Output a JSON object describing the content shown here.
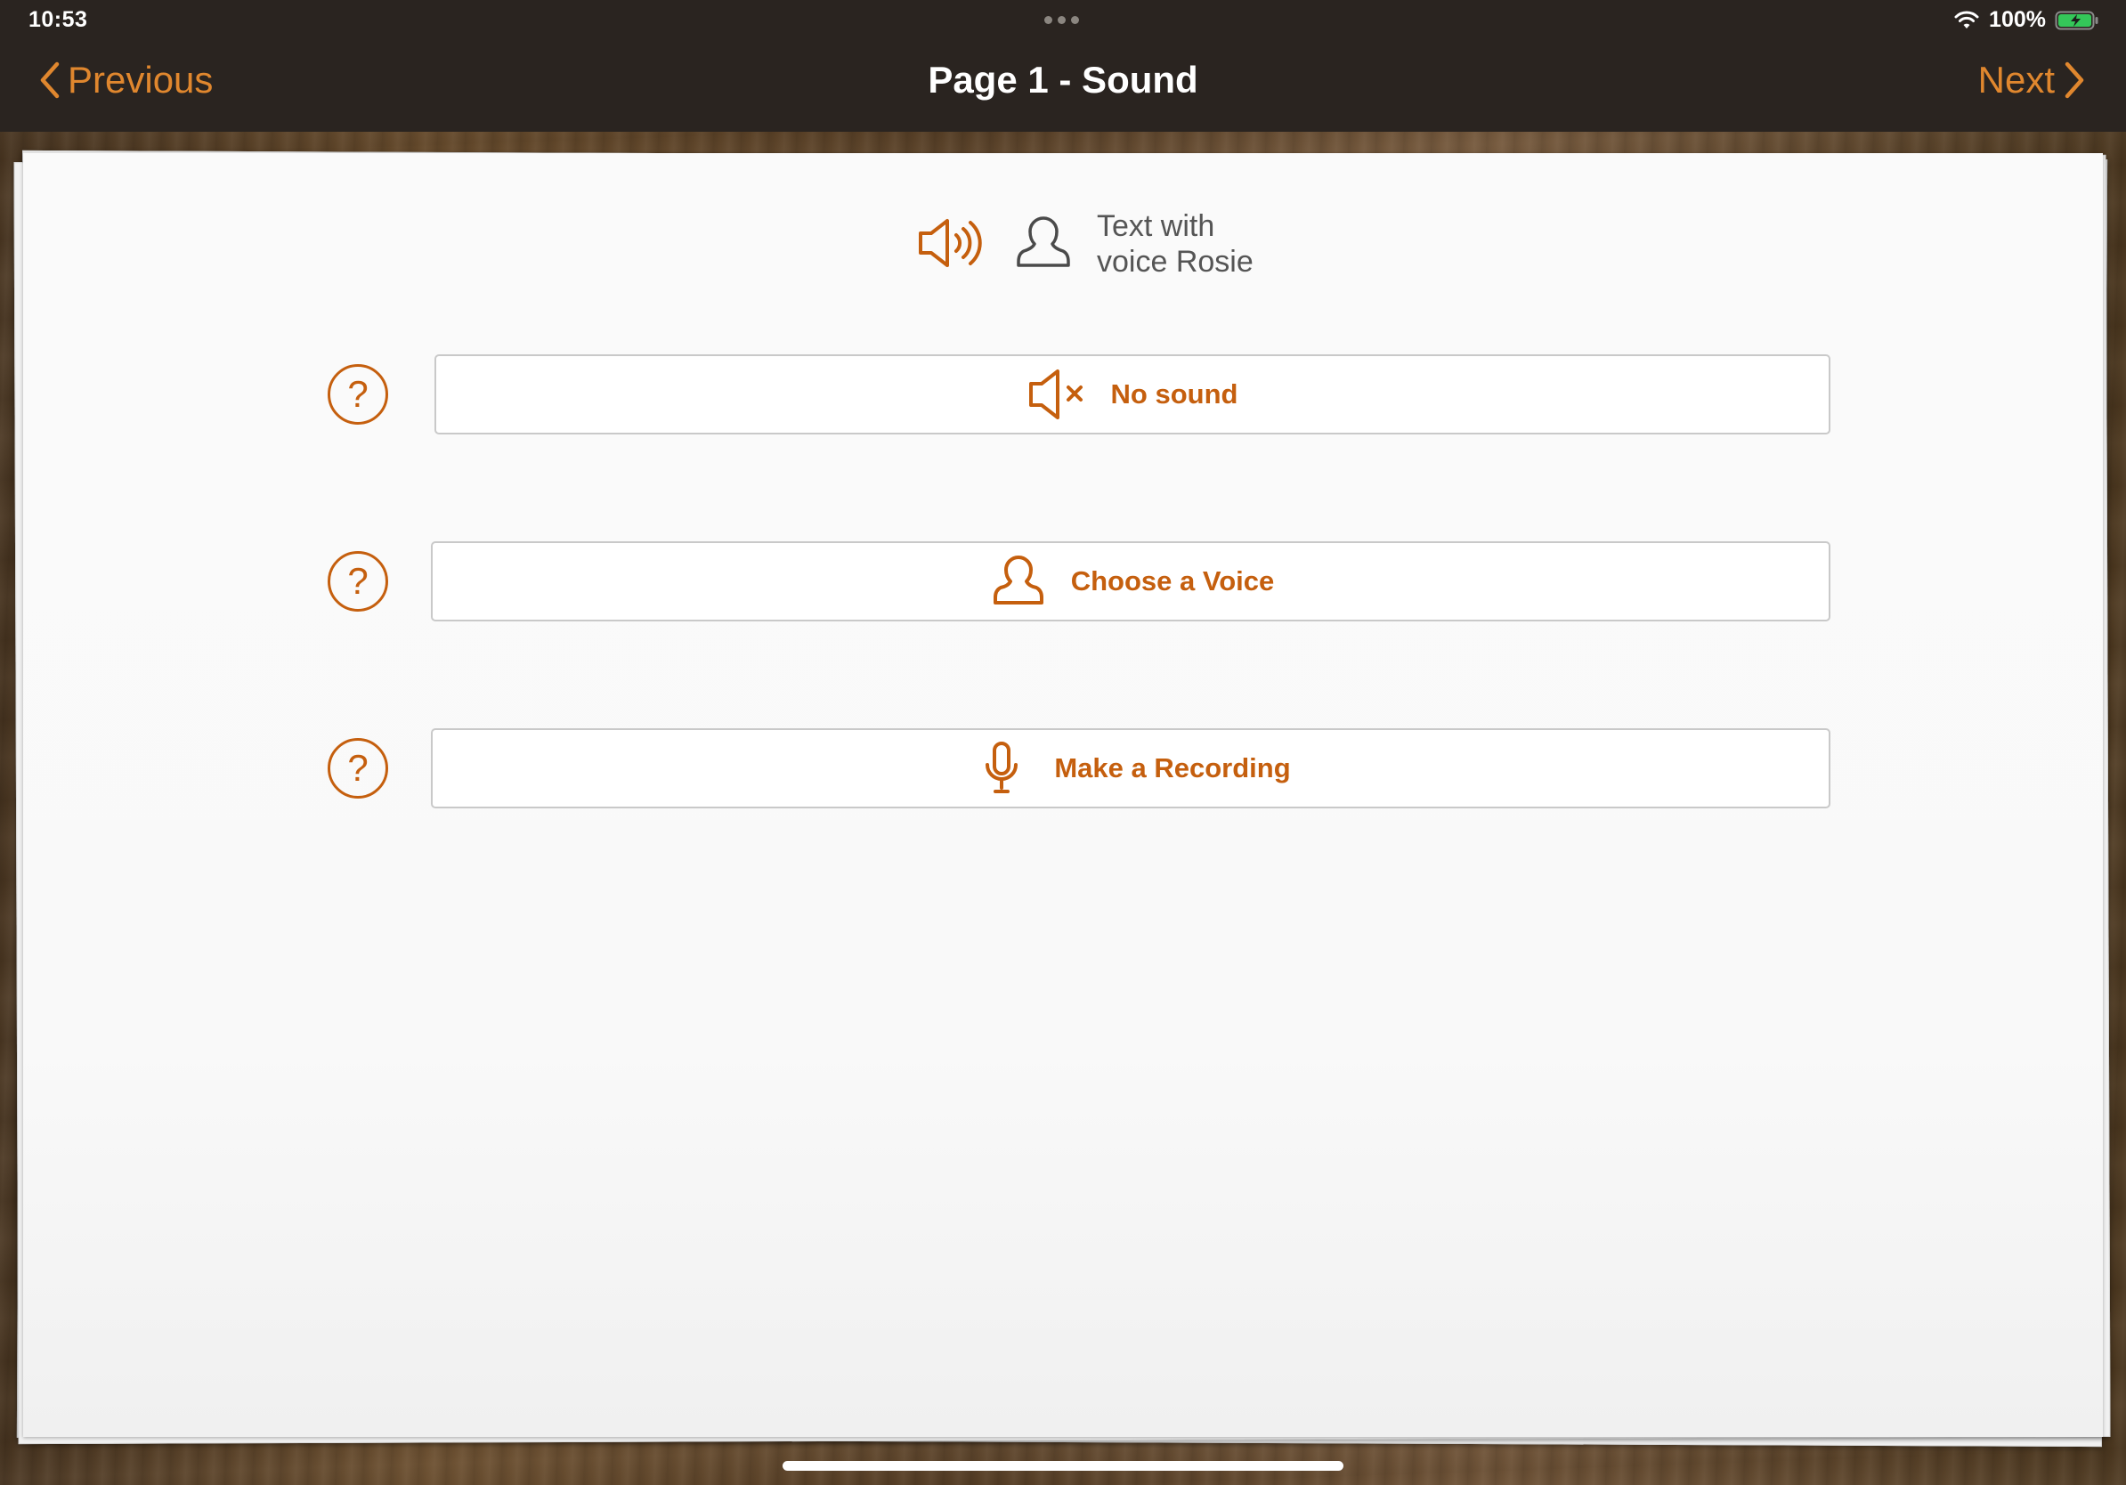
{
  "status_bar": {
    "time": "10:53",
    "battery_percent": "100%"
  },
  "nav": {
    "prev_label": "Previous",
    "next_label": "Next",
    "title": "Page 1 - Sound"
  },
  "voice_header": {
    "line1": "Text with",
    "line2": "voice Rosie",
    "icons": [
      "speaker-on-icon",
      "person-icon"
    ]
  },
  "options": [
    {
      "label": "No sound",
      "icon": "speaker-muted-icon"
    },
    {
      "label": "Choose a Voice",
      "icon": "person-icon"
    },
    {
      "label": "Make a Recording",
      "icon": "microphone-icon"
    }
  ],
  "help_symbol": "?",
  "colors": {
    "accent": "#c55f0e",
    "nav_accent": "#e0872e",
    "topbar_bg": "#2a2420",
    "paper_bg": "#fafafa"
  }
}
